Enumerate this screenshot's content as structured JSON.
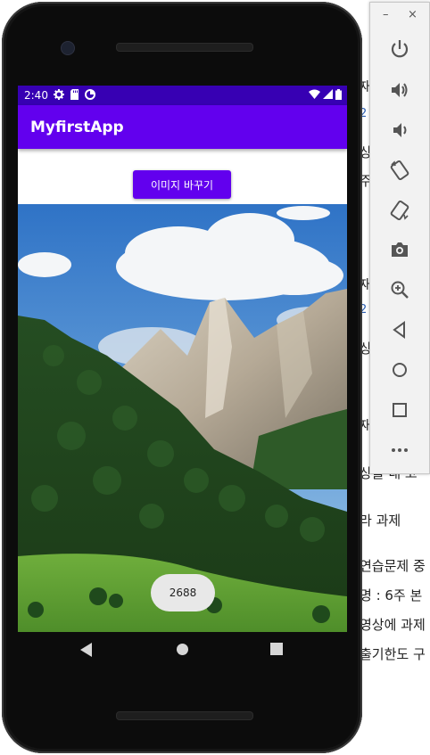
{
  "background_document": {
    "lines": [
      {
        "text": "재",
        "style": "normal"
      },
      {
        "text": "2",
        "style": "blue"
      },
      {
        "text": "상",
        "style": "normal"
      },
      {
        "text": "주",
        "style": "normal"
      },
      {
        "text": "재",
        "style": "normal"
      },
      {
        "text": "2",
        "style": "blue"
      },
      {
        "text": "상",
        "style": "normal"
      },
      {
        "text": "재",
        "style": "normal"
      },
      {
        "text": "상을 내 코",
        "style": "normal"
      },
      {
        "text": "라 과제",
        "style": "normal"
      },
      {
        "text": "연습문제 중",
        "style": "normal"
      },
      {
        "text": "명 : 6주 본",
        "style": "normal"
      },
      {
        "text": "영상에 과제",
        "style": "normal"
      },
      {
        "text": "출기한도 구",
        "style": "normal"
      }
    ]
  },
  "status_bar": {
    "time": "2:40",
    "left_icons": [
      "gear-icon",
      "sd-card-icon",
      "data-saver-icon"
    ],
    "right_icons": [
      "wifi-icon",
      "signal-icon",
      "battery-icon"
    ],
    "color": "#3700b3"
  },
  "app_bar": {
    "title": "MyfirstApp",
    "color": "#6200ee"
  },
  "main": {
    "change_image_button": "이미지 바꾸기",
    "image": "mountain-landscape-photo",
    "toast_text": "2688"
  },
  "nav_bar": {
    "buttons": [
      "back-icon",
      "home-icon",
      "recents-icon"
    ]
  },
  "emulator_panel": {
    "window_controls": [
      "–",
      "×"
    ],
    "tools": [
      "power-icon",
      "volume-up-icon",
      "volume-down-icon",
      "rotate-left-icon",
      "rotate-right-icon",
      "camera-icon",
      "zoom-icon",
      "back-icon",
      "home-icon",
      "overview-icon",
      "more-icon"
    ]
  }
}
